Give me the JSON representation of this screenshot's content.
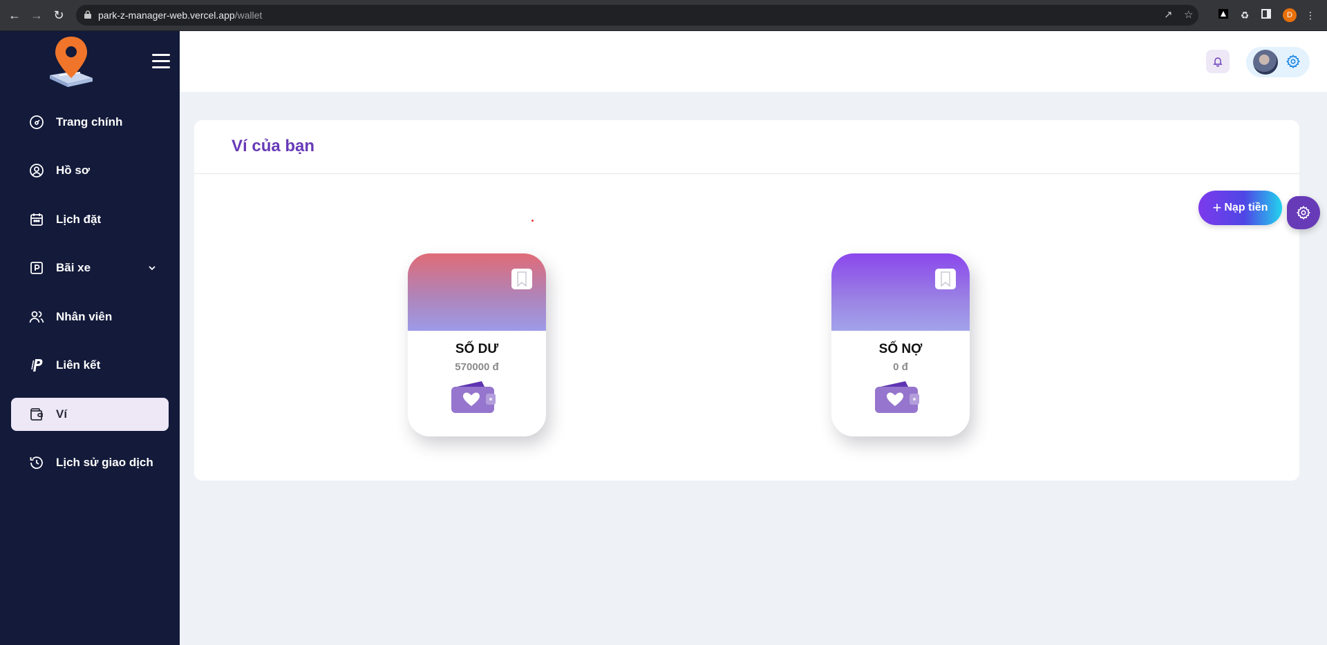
{
  "browser": {
    "url_host": "park-z-manager-web.vercel.app",
    "url_path": "/wallet",
    "profile_initial": "D"
  },
  "sidebar": {
    "items": [
      {
        "label": "Trang chính",
        "icon": "dashboard-icon"
      },
      {
        "label": "Hồ sơ",
        "icon": "user-circle-icon"
      },
      {
        "label": "Lịch đặt",
        "icon": "calendar-icon"
      },
      {
        "label": "Bãi xe",
        "icon": "parking-icon",
        "expandable": true
      },
      {
        "label": "Nhân viên",
        "icon": "users-icon"
      },
      {
        "label": "Liên kết",
        "icon": "paypal-icon"
      },
      {
        "label": "Ví",
        "icon": "wallet-icon",
        "active": true
      },
      {
        "label": "Lịch sử giao dịch",
        "icon": "history-icon"
      }
    ]
  },
  "main": {
    "title": "Ví của bạn",
    "topup_label": "Nạp tiền",
    "cards": {
      "balance": {
        "caption": "SỐ DƯ",
        "value": "570000 đ"
      },
      "debt": {
        "caption": "SỐ NỢ",
        "value": "0 đ"
      }
    }
  },
  "colors": {
    "sidebar_bg": "#131a3a",
    "accent": "#673ab7",
    "active_item_bg": "#ede7f6"
  }
}
